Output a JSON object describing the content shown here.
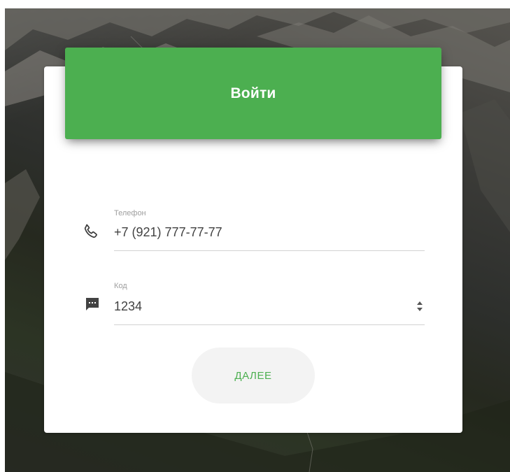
{
  "login_card": {
    "title": "Войти",
    "phone": {
      "label": "Телефон",
      "value": "+7 (921) 777-77-77",
      "icon": "phone-icon"
    },
    "code": {
      "label": "Код",
      "value": "1234",
      "icon": "message-icon"
    },
    "next_button_label": "ДАЛЕЕ"
  },
  "colors": {
    "accent": "#4caf50",
    "card_background": "#ffffff",
    "button_background": "#f3f3f3",
    "label_text": "#9e9e9e",
    "input_text": "#424242"
  }
}
